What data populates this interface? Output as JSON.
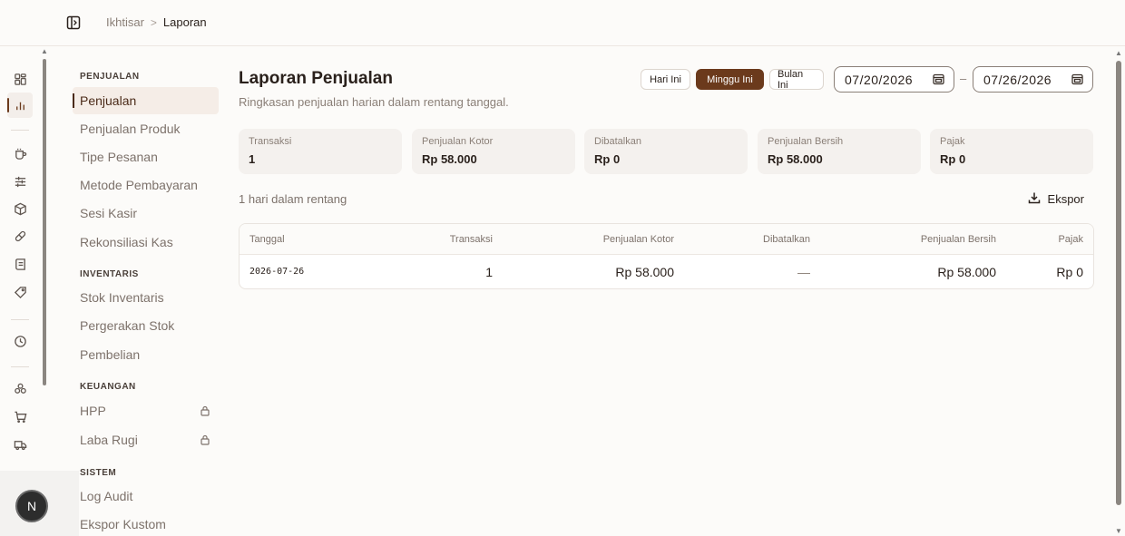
{
  "breadcrumb": {
    "parent": "Ikhtisar",
    "separator": ">",
    "current": "Laporan"
  },
  "rail": {
    "icons": [
      "dashboard-icon",
      "report-chart-icon",
      "coffee-cup-icon",
      "sliders-icon",
      "package-icon",
      "pill-icon",
      "receipt-icon",
      "tag-icon",
      "clock-icon",
      "ingredients-icon",
      "cart-icon",
      "truck-icon"
    ],
    "active": "report-chart-icon"
  },
  "user": {
    "initial": "N"
  },
  "nav": {
    "sections": [
      {
        "title": "PENJUALAN",
        "items": [
          {
            "label": "Penjualan",
            "active": true
          },
          {
            "label": "Penjualan Produk"
          },
          {
            "label": "Tipe Pesanan"
          },
          {
            "label": "Metode Pembayaran"
          },
          {
            "label": "Sesi Kasir"
          },
          {
            "label": "Rekonsiliasi Kas"
          }
        ]
      },
      {
        "title": "INVENTARIS",
        "items": [
          {
            "label": "Stok Inventaris"
          },
          {
            "label": "Pergerakan Stok"
          },
          {
            "label": "Pembelian"
          }
        ]
      },
      {
        "title": "KEUANGAN",
        "items": [
          {
            "label": "HPP",
            "locked": true
          },
          {
            "label": "Laba Rugi",
            "locked": true
          }
        ]
      },
      {
        "title": "SISTEM",
        "items": [
          {
            "label": "Log Audit"
          },
          {
            "label": "Ekspor Kustom"
          }
        ]
      }
    ]
  },
  "main": {
    "title": "Laporan Penjualan",
    "subtitle": "Ringkasan penjualan harian dalam rentang tanggal.",
    "range_buttons": [
      {
        "label": "Hari Ini",
        "active": false
      },
      {
        "label": "Minggu Ini",
        "active": true
      },
      {
        "label": "Bulan Ini",
        "active": false
      }
    ],
    "date_from": "07/20/2026",
    "date_separator": "–",
    "date_to": "07/26/2026",
    "stats": [
      {
        "label": "Transaksi",
        "value": "1"
      },
      {
        "label": "Penjualan Kotor",
        "value": "Rp 58.000"
      },
      {
        "label": "Dibatalkan",
        "value": "Rp 0"
      },
      {
        "label": "Penjualan Bersih",
        "value": "Rp 58.000"
      },
      {
        "label": "Pajak",
        "value": "Rp 0"
      }
    ],
    "range_count": "1 hari dalam rentang",
    "export_label": "Ekspor",
    "table": {
      "columns": [
        "Tanggal",
        "Transaksi",
        "Penjualan Kotor",
        "Dibatalkan",
        "Penjualan Bersih",
        "Pajak"
      ],
      "rows": [
        [
          "2026-07-26",
          "1",
          "Rp 58.000",
          "—",
          "Rp 58.000",
          "Rp 0"
        ]
      ]
    }
  },
  "colors": {
    "accent": "#6b3a1c",
    "background": "#fcfbf9",
    "card": "#f4f1ee"
  }
}
